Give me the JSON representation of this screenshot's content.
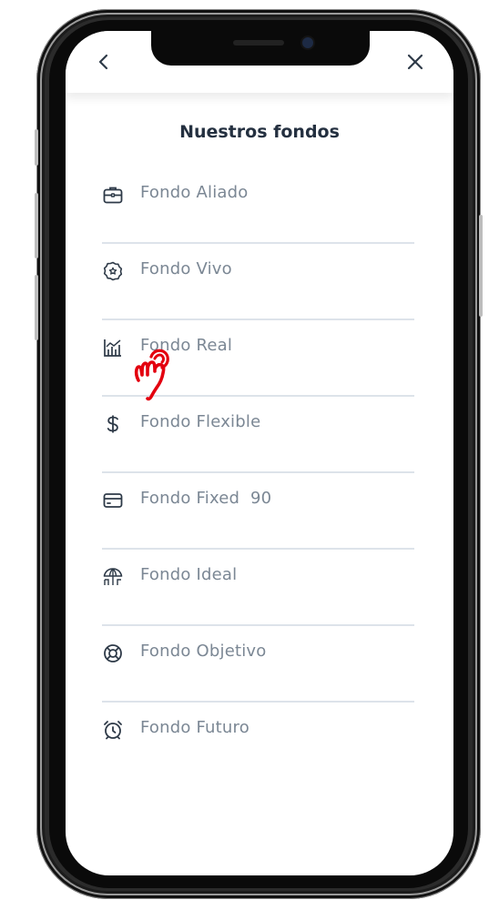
{
  "header": {
    "back_icon": "chevron-left-icon",
    "close_icon": "close-icon"
  },
  "page": {
    "title": "Nuestros fondos"
  },
  "funds": [
    {
      "label": "Fondo Aliado",
      "icon": "briefcase-icon"
    },
    {
      "label": "Fondo Vivo",
      "icon": "badge-star-icon"
    },
    {
      "label": "Fondo Real",
      "icon": "bar-chart-line-icon"
    },
    {
      "label": "Fondo Flexible",
      "icon": "dollar-icon"
    },
    {
      "label": "Fondo Fixed  90",
      "icon": "credit-card-icon"
    },
    {
      "label": "Fondo Ideal",
      "icon": "umbrella-beach-icon"
    },
    {
      "label": "Fondo Objetivo",
      "icon": "lifebuoy-icon"
    },
    {
      "label": "Fondo Futuro",
      "icon": "alarm-clock-icon"
    }
  ],
  "gesture": {
    "icon": "tap-hand-icon",
    "color": "#e3000f"
  },
  "colors": {
    "title": "#243040",
    "label": "#7b8794",
    "divider": "#dde3ea",
    "icon": "#2e3a48"
  }
}
